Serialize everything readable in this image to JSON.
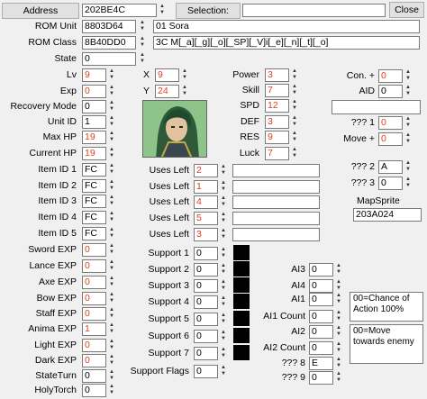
{
  "header": {
    "address_button": "Address",
    "address_value": "202BE4C",
    "selection_button": "Selection:",
    "selection_value": "",
    "close_button": "Close"
  },
  "rom": {
    "unit_label": "ROM Unit",
    "unit_value": "8803D64",
    "unit_name": "01 Sora",
    "class_label": "ROM Class",
    "class_value": "8B40DD0",
    "class_name": "3C M[_a][_g][_o][_SP][_V]i[_e][_n][_t][_o]"
  },
  "left": [
    {
      "label": "State",
      "value": "0"
    },
    {
      "label": "Lv",
      "value": "9"
    },
    {
      "label": "Exp",
      "value": "0"
    },
    {
      "label": "Recovery Mode",
      "value": "0"
    },
    {
      "label": "Unit ID",
      "value": "1"
    },
    {
      "label": "Max HP",
      "value": "19"
    },
    {
      "label": "Current HP",
      "value": "19"
    }
  ],
  "mid": [
    {
      "label": "X",
      "value": "9"
    },
    {
      "label": "Y",
      "value": "24"
    }
  ],
  "stats": [
    {
      "label": "Power",
      "value": "3"
    },
    {
      "label": "Skill",
      "value": "7"
    },
    {
      "label": "SPD",
      "value": "12"
    },
    {
      "label": "DEF",
      "value": "3"
    },
    {
      "label": "RES",
      "value": "9"
    },
    {
      "label": "Luck",
      "value": "7"
    }
  ],
  "right": [
    {
      "label": "Con. +",
      "value": "0"
    },
    {
      "label": "AID",
      "value": "0"
    },
    {
      "label": "??? 1",
      "value": "0"
    },
    {
      "label": "Move +",
      "value": "0"
    },
    {
      "label": "??? 2",
      "value": "A"
    },
    {
      "label": "??? 3",
      "value": "0"
    }
  ],
  "items": [
    {
      "label": "Item ID 1",
      "value": "FC",
      "uses_label": "Uses Left",
      "uses": "2"
    },
    {
      "label": "Item ID 2",
      "value": "FC",
      "uses_label": "Uses Left",
      "uses": "1"
    },
    {
      "label": "Item ID 3",
      "value": "FC",
      "uses_label": "Uses Left",
      "uses": "4"
    },
    {
      "label": "Item ID 4",
      "value": "FC",
      "uses_label": "Uses Left",
      "uses": "5"
    },
    {
      "label": "Item ID 5",
      "value": "FC",
      "uses_label": "Uses Left",
      "uses": "3"
    }
  ],
  "mapsprite": {
    "label": "MapSprite",
    "value": "203A024"
  },
  "weapon_exp": [
    {
      "label": "Sword EXP",
      "value": "0"
    },
    {
      "label": "Lance EXP",
      "value": "0"
    },
    {
      "label": "Axe EXP",
      "value": "0"
    },
    {
      "label": "Bow EXP",
      "value": "0"
    },
    {
      "label": "Staff EXP",
      "value": "0"
    },
    {
      "label": "Anima EXP",
      "value": "1"
    },
    {
      "label": "Light EXP",
      "value": "0"
    },
    {
      "label": "Dark EXP",
      "value": "0"
    },
    {
      "label": "StateTurn",
      "value": "0"
    },
    {
      "label": "HolyTorch",
      "value": "0"
    }
  ],
  "supports": [
    {
      "label": "Support 1",
      "value": "0"
    },
    {
      "label": "Support 2",
      "value": "0"
    },
    {
      "label": "Support 3",
      "value": "0"
    },
    {
      "label": "Support 4",
      "value": "0"
    },
    {
      "label": "Support 5",
      "value": "0"
    },
    {
      "label": "Support 6",
      "value": "0"
    },
    {
      "label": "Support 7",
      "value": "0"
    },
    {
      "label": "Support Flags",
      "value": "0"
    }
  ],
  "ai": [
    {
      "label": "AI3",
      "value": "0"
    },
    {
      "label": "AI4",
      "value": "0"
    },
    {
      "label": "AI1",
      "value": "0"
    },
    {
      "label": "AI1 Count",
      "value": "0"
    },
    {
      "label": "AI2",
      "value": "0"
    },
    {
      "label": "AI2 Count",
      "value": "0"
    },
    {
      "label": "??? 8",
      "value": "E"
    },
    {
      "label": "??? 9",
      "value": "0"
    }
  ],
  "ai_notes": {
    "ai1": "00=Chance of Action 100%",
    "ai2": "00=Move towards enemy"
  }
}
